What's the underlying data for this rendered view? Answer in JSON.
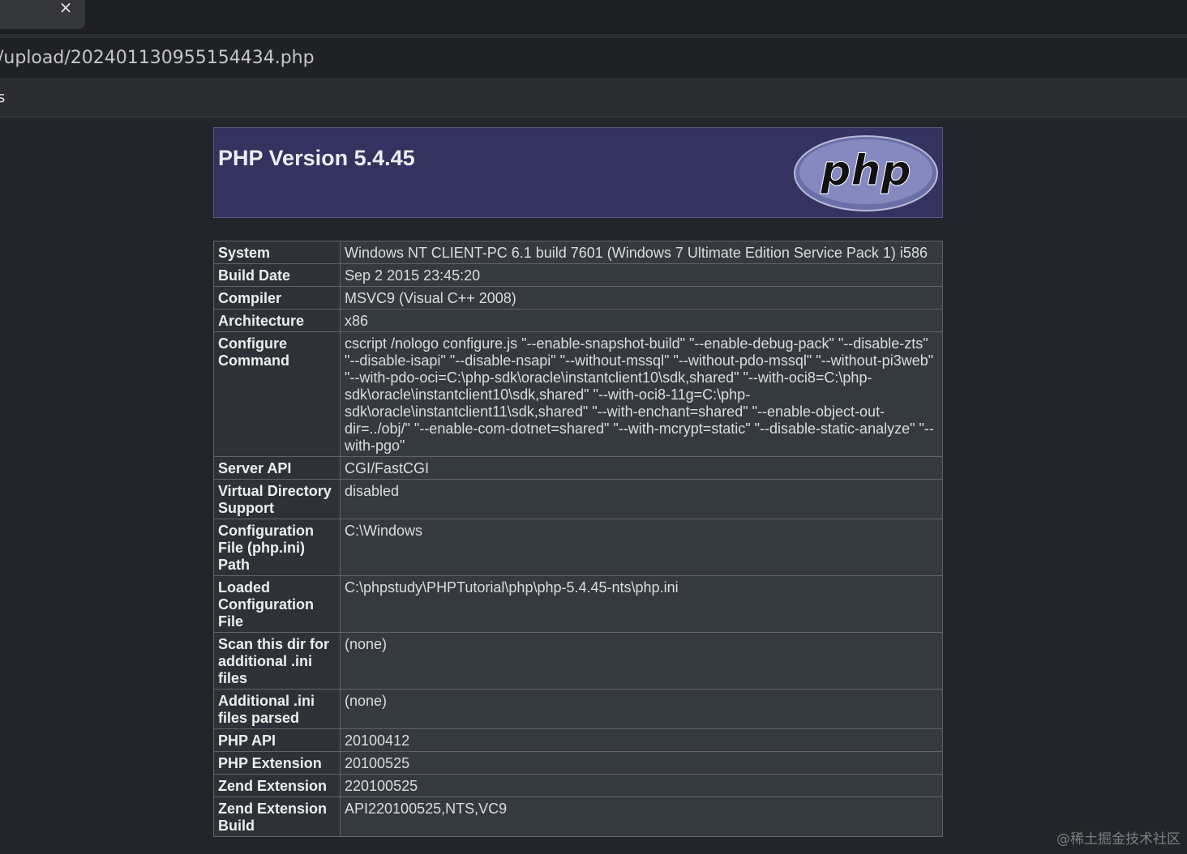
{
  "browser": {
    "url": "/upload/2024011309551544​34.php",
    "bookmarks_fragment": "s",
    "tab_close_glyph": "×"
  },
  "phpinfo": {
    "title": "PHP Version 5.4.45",
    "logo_text": "php",
    "rows": [
      {
        "key": "System",
        "value": "Windows NT CLIENT-PC 6.1 build 7601 (Windows 7 Ultimate Edition Service Pack 1) i586"
      },
      {
        "key": "Build Date",
        "value": "Sep 2 2015 23:45:20"
      },
      {
        "key": "Compiler",
        "value": "MSVC9 (Visual C++ 2008)"
      },
      {
        "key": "Architecture",
        "value": "x86"
      },
      {
        "key": "Configure Command",
        "value": "cscript /nologo configure.js \"--enable-snapshot-build\" \"--enable-debug-pack\" \"--disable-zts\" \"--disable-isapi\" \"--disable-nsapi\" \"--without-mssql\" \"--without-pdo-mssql\" \"--without-pi3web\" \"--with-pdo-oci=C:\\php-sdk\\oracle\\instantclient10\\sdk,shared\" \"--with-oci8=C:\\php-sdk\\oracle\\instantclient10\\sdk,shared\" \"--with-oci8-11g=C:\\php-sdk\\oracle\\instantclient11\\sdk,shared\" \"--with-enchant=shared\" \"--enable-object-out-dir=../obj/\" \"--enable-com-dotnet=shared\" \"--with-mcrypt=static\" \"--disable-static-analyze\" \"--with-pgo\""
      },
      {
        "key": "Server API",
        "value": "CGI/FastCGI"
      },
      {
        "key": "Virtual Directory Support",
        "value": "disabled"
      },
      {
        "key": "Configuration File (php.ini) Path",
        "value": "C:\\Windows"
      },
      {
        "key": "Loaded Configuration File",
        "value": "C:\\phpstudy\\PHPTutorial\\php\\php-5.4.45-nts\\php.ini"
      },
      {
        "key": "Scan this dir for additional .ini files",
        "value": "(none)"
      },
      {
        "key": "Additional .ini files parsed",
        "value": "(none)"
      },
      {
        "key": "PHP API",
        "value": "20100412"
      },
      {
        "key": "PHP Extension",
        "value": "20100525"
      },
      {
        "key": "Zend Extension",
        "value": "220100525"
      },
      {
        "key": "Zend Extension Build",
        "value": "API220100525,NTS,VC9"
      }
    ]
  },
  "watermark": "@稀土掘金技术社区",
  "colors": {
    "page_bg": "#222529",
    "header_bg": "#34325f",
    "key_cell_bg": "#2e3238",
    "value_cell_bg": "#353a40"
  }
}
